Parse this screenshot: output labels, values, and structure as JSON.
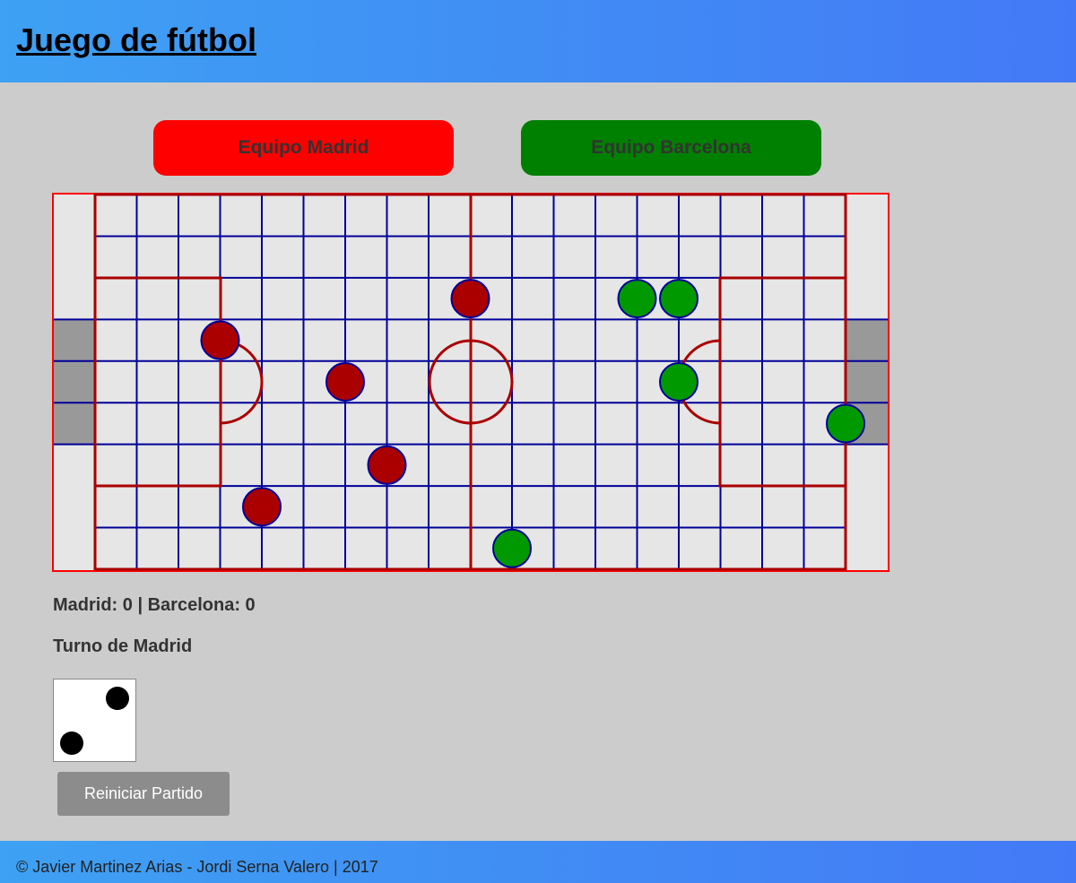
{
  "header": {
    "title": "Juego de fútbol"
  },
  "teams": {
    "madrid": {
      "label": "Equipo Madrid",
      "color": "#ff0000",
      "token_color": "#aa0000"
    },
    "barcelona": {
      "label": "Equipo Barcelona",
      "color": "#008000",
      "token_color": "#009900"
    }
  },
  "board": {
    "columns": 20,
    "rows": 9,
    "line_color": "#000099",
    "field_marking_color": "#aa0000",
    "goal_color": "#999999",
    "field_color": "#e6e6e6",
    "madrid_players": [
      {
        "col": 8,
        "row": 2
      },
      {
        "col": 2,
        "row": 3
      },
      {
        "col": 5,
        "row": 4
      },
      {
        "col": 6,
        "row": 6
      },
      {
        "col": 3,
        "row": 7
      }
    ],
    "barcelona_players": [
      {
        "col": 12,
        "row": 2
      },
      {
        "col": 13,
        "row": 2
      },
      {
        "col": 13,
        "row": 4
      },
      {
        "col": 17,
        "row": 5
      },
      {
        "col": 9,
        "row": 8
      }
    ]
  },
  "status": {
    "score": "Madrid: 0 | Barcelona: 0",
    "turn": "Turno de Madrid"
  },
  "die": {
    "value": 2
  },
  "controls": {
    "reset_label": "Reiniciar Partido"
  },
  "footer": {
    "text": "© Javier Martinez Arias - Jordi Serna Valero | 2017"
  }
}
